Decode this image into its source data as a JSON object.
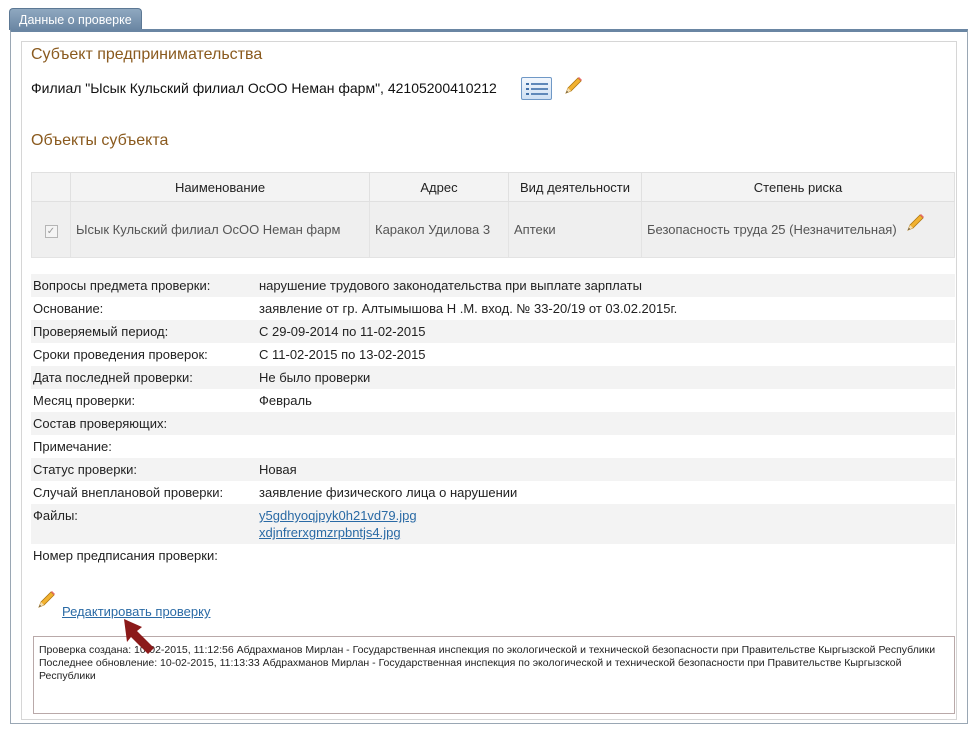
{
  "tab": {
    "label": "Данные о проверке"
  },
  "subject": {
    "heading": "Субъект предпринимательства",
    "name": "Филиал \"Ысык Кульский филиал ОсОО Неман фарм\", 42105200410212",
    "list_icon": "list-icon",
    "edit_icon": "pencil-icon"
  },
  "objects": {
    "heading": "Объекты субъекта",
    "columns": [
      "",
      "Наименование",
      "Адрес",
      "Вид деятельности",
      "Степень риска"
    ],
    "rows": [
      {
        "checked": true,
        "name": "Ысык Кульский филиал ОсОО Неман фарм",
        "address": "Каракол Удилова 3",
        "activity": "Аптеки",
        "risk": "Безопасность труда 25 (Незначительная)"
      }
    ]
  },
  "details": {
    "questions_label": "Вопросы предмета проверки:",
    "questions_value": "нарушение трудового законодательства при выплате зарплаты",
    "basis_label": "Основание:",
    "basis_value": "заявление от гр. Алтымышова Н .М. вход. № 33-20/19 от 03.02.2015г.",
    "period_label": "Проверяемый период:",
    "period_value": "С 29-09-2014 по 11-02-2015",
    "terms_label": "Сроки проведения проверок:",
    "terms_value": "С 11-02-2015 по 13-02-2015",
    "last_label": "Дата последней проверки:",
    "last_value": "Не было проверки",
    "month_label": "Месяц проверки:",
    "month_value": "Февраль",
    "staff_label": "Состав проверяющих:",
    "staff_value": "",
    "note_label": "Примечание:",
    "note_value": "",
    "status_label": "Статус проверки:",
    "status_value": "Новая",
    "unplanned_label": "Случай внеплановой проверки:",
    "unplanned_value": "заявление физического лица о нарушении",
    "files_label": "Файлы:",
    "files": [
      "y5gdhyoqjpyk0h21vd79.jpg",
      "xdjnfrerxgmzrpbntjs4.jpg"
    ],
    "order_label": "Номер предписания проверки:",
    "order_value": ""
  },
  "edit": {
    "label": "Редактировать проверку",
    "icon": "pencil-icon"
  },
  "log": {
    "created": "Проверка создана: 10-02-2015, 11:12:56 Абдрахманов Мирлан - Государственная инспекция по экологической и технической безопасности при Правительстве Кыргызской Республики",
    "updated": "Последнее обновление: 10-02-2015, 11:13:33 Абдрахманов Мирлан - Государственная инспекция по экологической и технической безопасности при Правительстве Кыргызской Республики"
  },
  "colors": {
    "heading": "#8a5a1e",
    "link": "#2a6aa5",
    "tab": "#6a86a3",
    "arrow": "#8b1a1a"
  }
}
